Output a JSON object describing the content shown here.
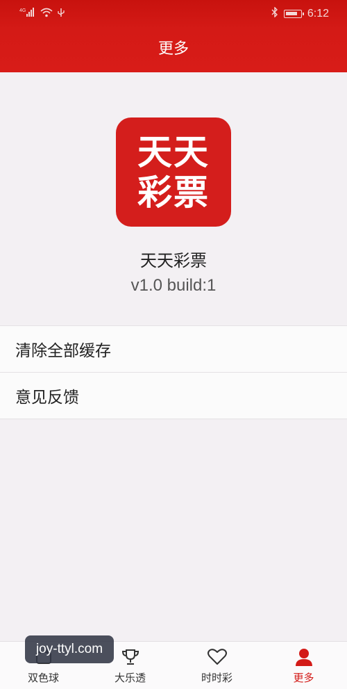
{
  "status_bar": {
    "network": "4G",
    "time": "6:12"
  },
  "header": {
    "title": "更多"
  },
  "app": {
    "icon_line1": "天天",
    "icon_line2": "彩票",
    "name": "天天彩票",
    "version": "v1.0 build:1"
  },
  "menu": {
    "items": [
      {
        "label": "清除全部缓存"
      },
      {
        "label": "意见反馈"
      }
    ]
  },
  "tabbar": {
    "tabs": [
      {
        "label": "双色球",
        "icon": "ball-icon",
        "active": false
      },
      {
        "label": "大乐透",
        "icon": "trophy-icon",
        "active": false
      },
      {
        "label": "时时彩",
        "icon": "heart-icon",
        "active": false
      },
      {
        "label": "更多",
        "icon": "person-icon",
        "active": true
      }
    ]
  },
  "watermark": {
    "text": "joy-ttyl.com"
  },
  "colors": {
    "brand_red": "#d41a16",
    "active_tab": "#d31b18",
    "background": "#f3f0f3"
  }
}
